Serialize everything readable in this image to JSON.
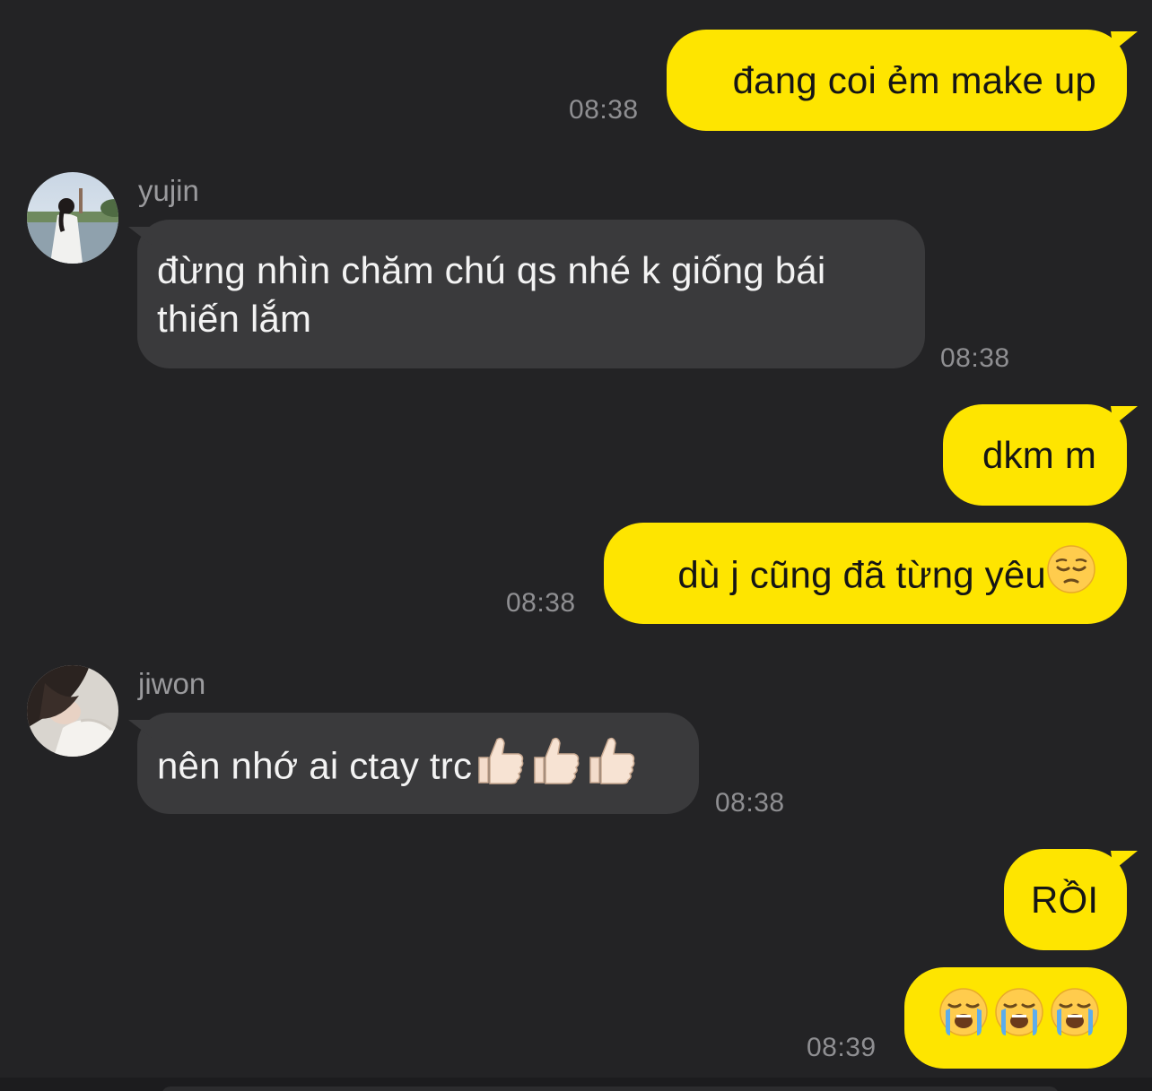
{
  "messages": [
    {
      "id": "m1",
      "direction": "outgoing",
      "text": "đang coi ẻm make up",
      "time": "08:38"
    },
    {
      "id": "m2",
      "direction": "incoming",
      "sender": "yujin",
      "text_line1": "đừng nhìn chăm chú qs nhé k giống bái",
      "text_line2": "thiến lắm",
      "time": "08:38"
    },
    {
      "id": "m3",
      "direction": "outgoing",
      "text": "dkm m"
    },
    {
      "id": "m4",
      "direction": "outgoing",
      "text": "dù j cũng đã từng yêu",
      "emoji": "pensive-face-icon",
      "time": "08:38"
    },
    {
      "id": "m5",
      "direction": "incoming",
      "sender": "jiwon",
      "text": "nên nhớ ai ctay trc",
      "emoji": "thumbs-up-icon",
      "emoji_count": 3,
      "time": "08:38"
    },
    {
      "id": "m6",
      "direction": "outgoing",
      "text": "RỒI"
    },
    {
      "id": "m7",
      "direction": "outgoing",
      "emoji": "loudly-crying-face-icon",
      "emoji_count": 3,
      "time": "08:39"
    }
  ],
  "colors": {
    "background": "#232325",
    "outgoing_bubble": "#fee500",
    "incoming_bubble": "#3a3a3c",
    "timestamp": "#8f8f92"
  }
}
